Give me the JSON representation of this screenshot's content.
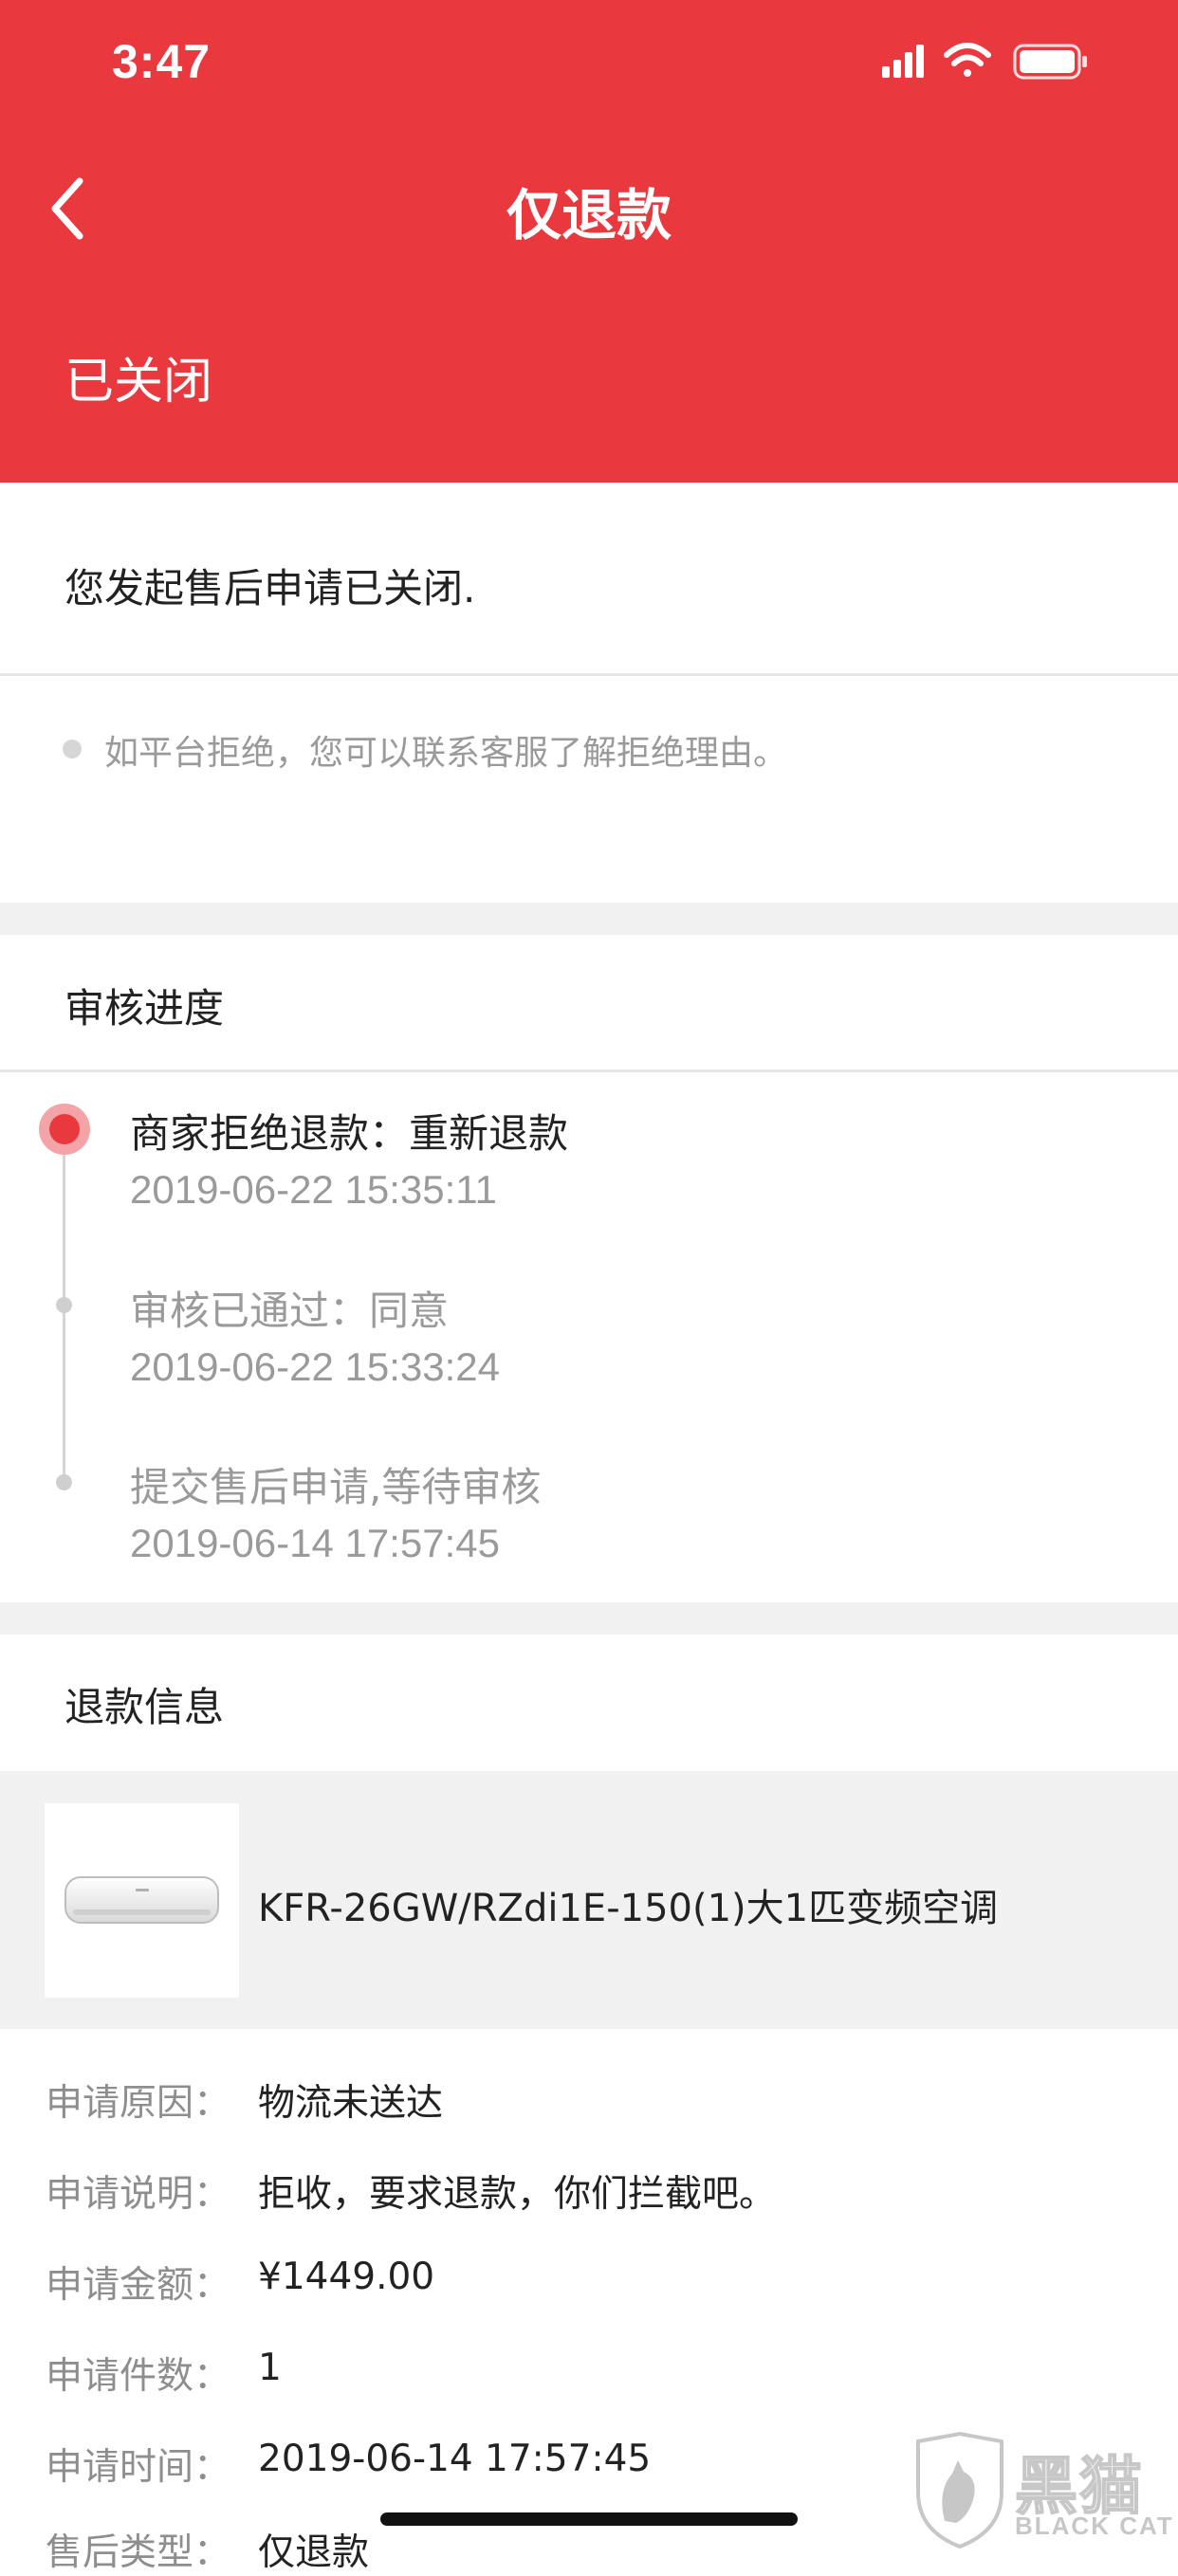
{
  "status_bar": {
    "time": "3:47",
    "icons": [
      "cellular-signal-icon",
      "wifi-icon",
      "battery-icon"
    ]
  },
  "nav": {
    "title": "仅退款",
    "back_icon": "chevron-left-icon"
  },
  "status": {
    "label": "已关闭"
  },
  "notice": {
    "text": "您发起售后申请已关闭.",
    "hint": "如平台拒绝，您可以联系客服了解拒绝理由。"
  },
  "progress": {
    "title": "审核进度",
    "steps": [
      {
        "title": "商家拒绝退款：重新退款",
        "time": "2019-06-22 15:35:11",
        "active": true
      },
      {
        "title": "审核已通过：同意",
        "time": "2019-06-22 15:33:24",
        "active": false
      },
      {
        "title": "提交售后申请,等待审核",
        "time": "2019-06-14 17:57:45",
        "active": false
      }
    ]
  },
  "refund": {
    "title": "退款信息",
    "product": {
      "name": "KFR-26GW/RZdi1E-150(1)大1匹变频空调",
      "image": "air-conditioner-image"
    },
    "fields": [
      {
        "label": "申请原因：",
        "value": "物流未送达"
      },
      {
        "label": "申请说明：",
        "value": "拒收，要求退款，你们拦截吧。"
      },
      {
        "label": "申请金额：",
        "value": "¥1449.00"
      },
      {
        "label": "申请件数：",
        "value": "1"
      },
      {
        "label": "申请时间：",
        "value": "2019-06-14 17:57:45"
      },
      {
        "label": "售后类型：",
        "value": "仅退款"
      }
    ]
  },
  "watermark": {
    "brand": "黑猫",
    "sub": "BLACK CAT"
  },
  "colors": {
    "brand_red": "#e9393f",
    "muted_text": "#9a9a9a",
    "gap_gray": "#f1f1f1"
  }
}
